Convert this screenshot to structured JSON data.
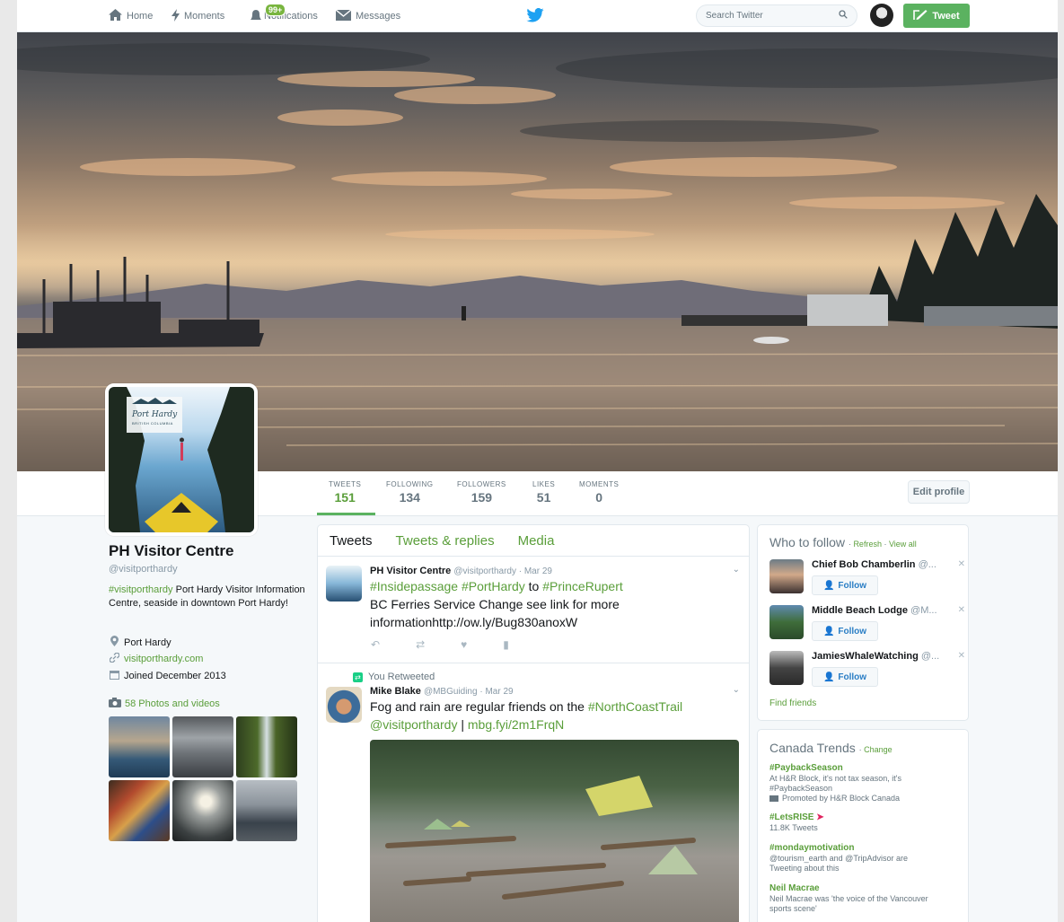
{
  "nav": {
    "home": "Home",
    "moments": "Moments",
    "notifications": "Notifications",
    "notifications_badge": "99+",
    "messages": "Messages",
    "search_placeholder": "Search Twitter",
    "tweet_button": "Tweet"
  },
  "stats": [
    {
      "label": "TWEETS",
      "value": "151"
    },
    {
      "label": "FOLLOWING",
      "value": "134"
    },
    {
      "label": "FOLLOWERS",
      "value": "159"
    },
    {
      "label": "LIKES",
      "value": "51"
    },
    {
      "label": "MOMENTS",
      "value": "0"
    }
  ],
  "edit_profile": "Edit profile",
  "profile": {
    "name": "PH Visitor Centre",
    "handle": "@visitporthardy",
    "bio_tag": "#visitporthardy",
    "bio_text": " Port Hardy Visitor Information Centre, seaside in downtown Port Hardy!",
    "location": "Port Hardy",
    "website": "visitporthardy.com",
    "joined": "Joined December 2013",
    "photos_label": "58 Photos and videos",
    "avatar_title": "Port Hardy",
    "avatar_subtitle": "BRITISH COLUMBIA"
  },
  "timeline": {
    "tabs": [
      "Tweets",
      "Tweets & replies",
      "Media"
    ],
    "tweet1": {
      "name": "PH Visitor Centre",
      "handle": "@visitporthardy · Mar 29",
      "tags_line": "#Insidepassage #PortHardy",
      "to": " to ",
      "tag3": "#PrinceRupert",
      "text": "BC Ferries Service Change see link for more informationhttp://ow.ly/Bug830anoxW"
    },
    "retweet_label": "You Retweeted",
    "tweet2": {
      "name": "Mike Blake",
      "handle": "@MBGuiding · Mar 29",
      "text": "Fog and rain are regular friends on the ",
      "tag": "#NorthCoastTrail",
      "mention": "@visitporthardy",
      "sep": " | ",
      "link": "mbg.fyi/2m1FrqN"
    }
  },
  "who_to_follow": {
    "title": "Who to follow",
    "refresh": "Refresh",
    "view_all": "View all",
    "follow_label": "Follow",
    "find_friends": "Find friends",
    "items": [
      {
        "name": "Chief Bob Chamberlin",
        "handle": "@..."
      },
      {
        "name": "Middle Beach Lodge",
        "handle": "@M..."
      },
      {
        "name": "JamiesWhaleWatching",
        "handle": "@..."
      }
    ]
  },
  "trends": {
    "title": "Canada Trends",
    "change": "Change",
    "items": [
      {
        "name": "#PaybackSeason",
        "line1": "At H&R Block, it's not tax season, it's",
        "line2": "#PaybackSeason",
        "line3": "Promoted by H&R Block Canada"
      },
      {
        "name": "#LetsRISE",
        "line1": "11.8K Tweets"
      },
      {
        "name": "#mondaymotivation",
        "line1": "@tourism_earth and @TripAdvisor are",
        "line2": "Tweeting about this"
      },
      {
        "name": "Neil Macrae",
        "line1": "Neil Macrae was 'the voice of the Vancouver",
        "line2": "sports scene'"
      }
    ]
  }
}
